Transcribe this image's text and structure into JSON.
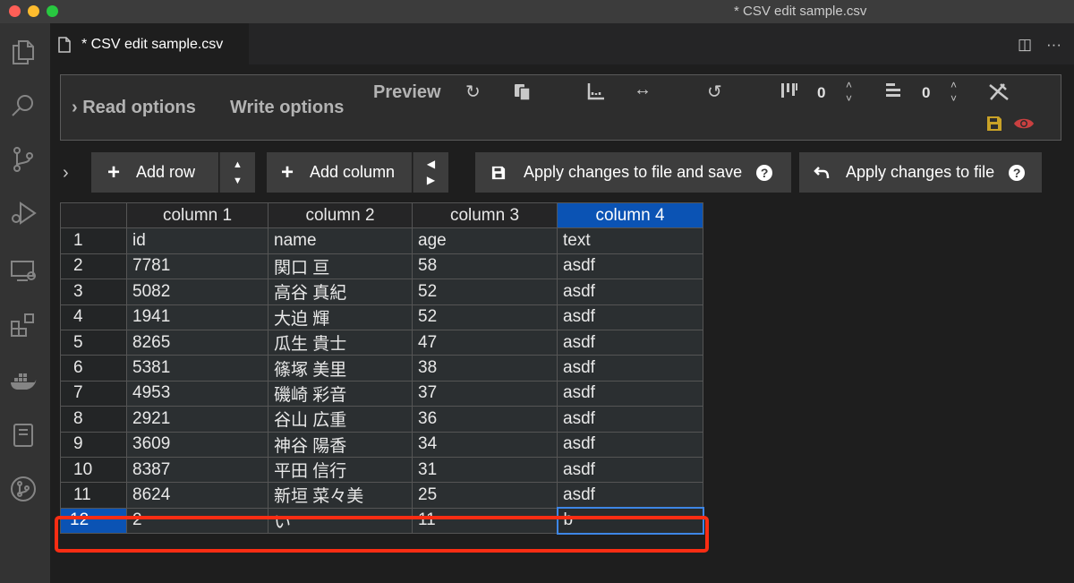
{
  "window": {
    "title": "* CSV edit sample.csv"
  },
  "tab": {
    "label": "* CSV edit sample.csv",
    "actions": [
      "split-editor-icon",
      "more-actions-icon"
    ]
  },
  "options": {
    "read_label": "Read options",
    "write_label": "Write options",
    "preview_label": "Preview",
    "fixed_columns_count": "0",
    "fixed_rows_count": "0"
  },
  "buttons": {
    "add_row": "Add row",
    "add_column": "Add column",
    "apply_save": "Apply changes to file and save",
    "apply": "Apply changes to file"
  },
  "table": {
    "headers": [
      "column 1",
      "column 2",
      "column 3",
      "column 4"
    ],
    "selected_header_index": 3,
    "rows": [
      [
        "1",
        "id",
        "name",
        "age",
        "text"
      ],
      [
        "2",
        "7781",
        "関口 亘",
        "58",
        "asdf"
      ],
      [
        "3",
        "5082",
        "高谷 真紀",
        "52",
        "asdf"
      ],
      [
        "4",
        "1941",
        "大迫 輝",
        "52",
        "asdf"
      ],
      [
        "5",
        "8265",
        "瓜生 貴士",
        "47",
        "asdf"
      ],
      [
        "6",
        "5381",
        "篠塚 美里",
        "38",
        "asdf"
      ],
      [
        "7",
        "4953",
        "磯崎 彩音",
        "37",
        "asdf"
      ],
      [
        "8",
        "2921",
        "谷山 広重",
        "36",
        "asdf"
      ],
      [
        "9",
        "3609",
        "神谷 陽香",
        "34",
        "asdf"
      ],
      [
        "10",
        "8387",
        "平田 信行",
        "31",
        "asdf"
      ],
      [
        "11",
        "8624",
        "新垣 菜々美",
        "25",
        "asdf"
      ],
      [
        "12",
        "2",
        "い",
        "11",
        "b"
      ]
    ]
  },
  "colors": {
    "selected": "#0b53b4",
    "highlight": "#fa2d13",
    "save_icon": "#c9a227",
    "preview_icon": "#c94040"
  }
}
